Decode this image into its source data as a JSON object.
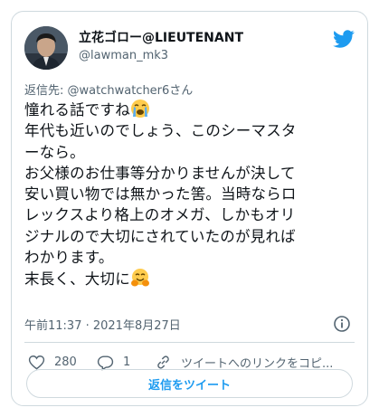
{
  "author": {
    "display_name": "立花ゴロー@LIEUTENANT",
    "handle": "@lawman_mk3"
  },
  "icons": {
    "brand": "twitter-bird-icon",
    "info": "info-icon",
    "like": "heart-icon",
    "reply": "reply-bubble-icon",
    "link": "link-icon",
    "emoji_1": "loudly-crying-face",
    "emoji_2": "hugging-face"
  },
  "colors": {
    "accent": "#1d9bf0",
    "muted": "#536471",
    "border": "#cfd9de"
  },
  "reply_to": {
    "prefix": "返信先: ",
    "mention": "@watchwatcher6さん"
  },
  "tweet": {
    "lines": [
      "憧れる話ですね",
      "年代も近いのでしょう、このシーマスタ",
      "ーなら。",
      "お父様のお仕事等分かりませんが決して",
      "安い買い物では無かった筈。当時ならロ",
      "レックスより格上のオメガ、しかもオリ",
      "ジナルので大切にされていたのが見れば",
      "わかります。",
      "末長く、大切に"
    ]
  },
  "timestamp": "午前11:37 · 2021年8月27日",
  "actions": {
    "likes": "280",
    "replies": "1",
    "copy_link": "ツイートへのリンクをコピ..."
  },
  "reply_button": "返信をツイート"
}
